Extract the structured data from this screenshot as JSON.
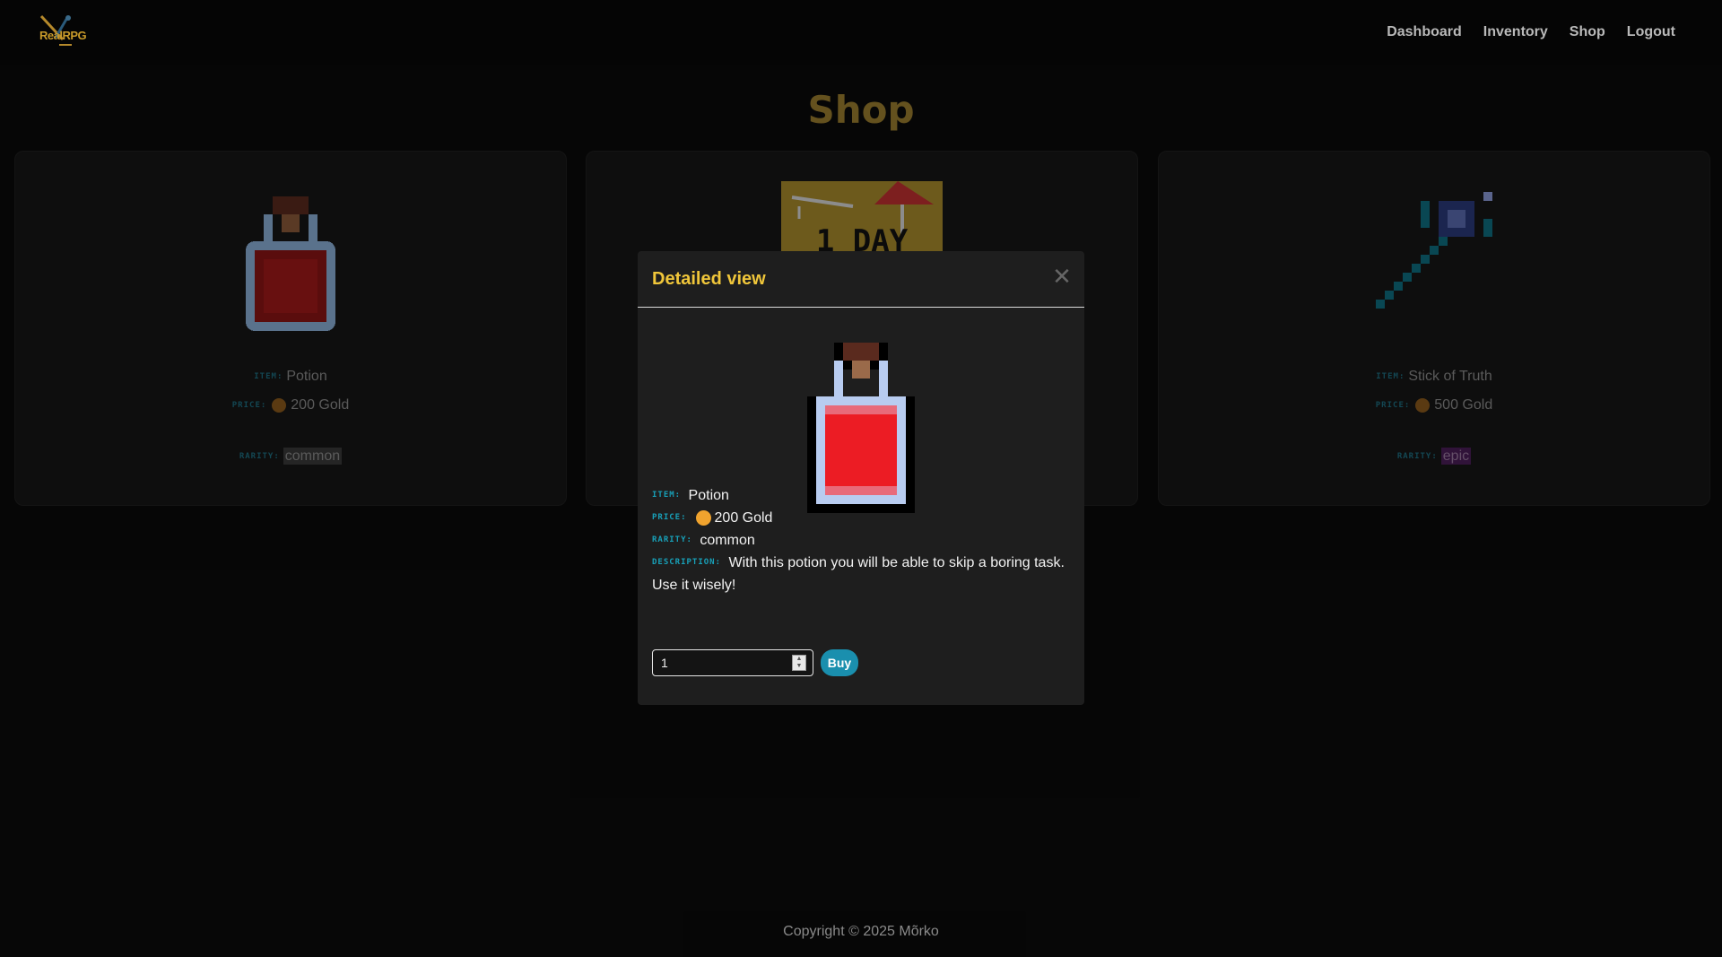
{
  "nav": {
    "logo_text": "RealRPG",
    "links": [
      "Dashboard",
      "Inventory",
      "Shop",
      "Logout"
    ]
  },
  "page": {
    "title": "Shop"
  },
  "labels": {
    "item": "Item:",
    "price": "Price:",
    "rarity": "Rarity:",
    "description": "Description:"
  },
  "cards": [
    {
      "item": "Potion",
      "price": "200 Gold",
      "rarity": "common",
      "icon": "potion-icon"
    },
    {
      "item": "",
      "price": "",
      "rarity": "",
      "icon": "1-day-vacation-icon",
      "image_text": "1 DAY"
    },
    {
      "item": "Stick of Truth",
      "price": "500 Gold",
      "rarity": "epic",
      "icon": "magic-wand-icon"
    }
  ],
  "modal": {
    "title": "Detailed view",
    "item": "Potion",
    "price": "200 Gold",
    "rarity": "common",
    "description": "With this potion you will be able to skip a boring task. Use it wisely!",
    "quantity": "1",
    "buy_label": "Buy"
  },
  "footer": {
    "text": "Copyright © 2025 Mõrko"
  },
  "colors": {
    "accent_gold": "#f0c63a",
    "title_gold": "#9a7d2f",
    "label_teal": "#18a0b8",
    "buy_button": "#1a8fae",
    "epic_badge": "#4a1e58"
  }
}
